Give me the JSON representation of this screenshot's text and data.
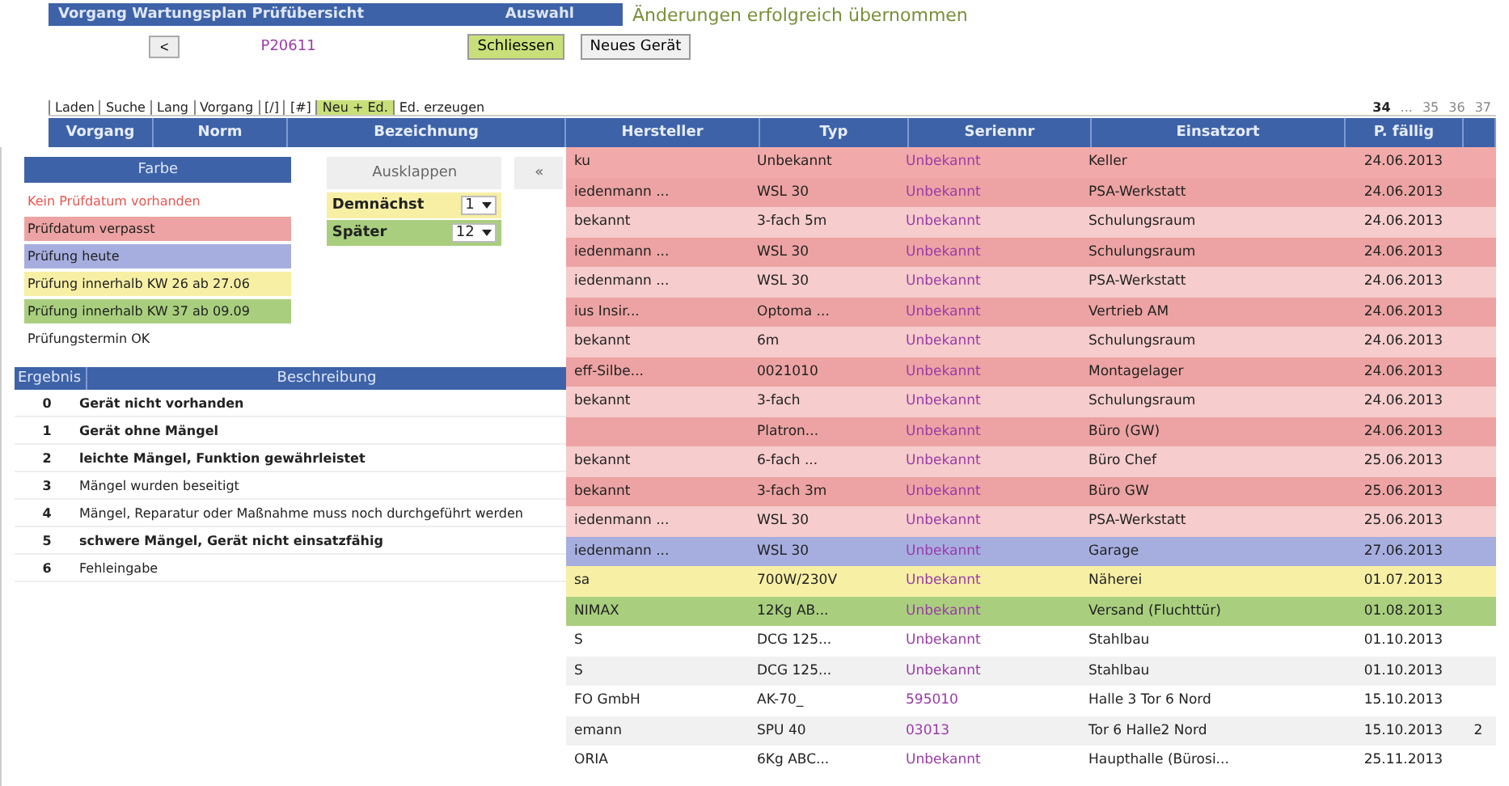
{
  "header": {
    "title": "Vorgang Wartungsplan Prüfübersicht",
    "selection": "Auswahl",
    "message": "Änderungen erfolgreich übernommen"
  },
  "toolbar": {
    "back_button": "<",
    "record": "P20611",
    "buttons": [
      {
        "label": "Schliessen",
        "kind": "primary"
      },
      {
        "label": "Neues Gerät",
        "kind": "plain"
      }
    ]
  },
  "tabs": [
    {
      "label": "Laden",
      "selected": false
    },
    {
      "label": "Suche",
      "selected": false
    },
    {
      "label": "Lang",
      "selected": false
    },
    {
      "label": "Vorgang",
      "selected": false
    },
    {
      "label": "[/]",
      "selected": false
    },
    {
      "label": "[#]",
      "selected": false
    },
    {
      "label": "Neu + Ed.",
      "selected": true
    },
    {
      "label": "Ed. erzeugen",
      "selected": false
    }
  ],
  "pagination": [
    {
      "label": "34",
      "selected": true
    },
    {
      "label": "...",
      "selected": false
    },
    {
      "label": "35",
      "selected": false
    },
    {
      "label": "36",
      "selected": false
    },
    {
      "label": "37",
      "selected": false
    }
  ],
  "table": {
    "columns": [
      "Vorgang",
      "Norm",
      "Bezeichnung",
      "Hersteller",
      "Typ",
      "Seriennr",
      "Einsatzort",
      "P. fällig"
    ],
    "rows": [
      {
        "hersteller": "ku",
        "typ": "Unbekannt",
        "seriennr": "Unbekannt",
        "einsatzort": "Keller",
        "faellig": "24.06.2013",
        "color": "#f2a9a9"
      },
      {
        "hersteller": "iedenmann ...",
        "typ": "WSL 30",
        "seriennr": "Unbekannt",
        "einsatzort": "PSA-Werkstatt",
        "faellig": "24.06.2013",
        "color": "#eda3a3"
      },
      {
        "hersteller": "bekannt",
        "typ": "3-fach 5m",
        "seriennr": "Unbekannt",
        "einsatzort": "Schulungsraum",
        "faellig": "24.06.2013",
        "color": "#f6cccc"
      },
      {
        "hersteller": "iedenmann ...",
        "typ": "WSL 30",
        "seriennr": "Unbekannt",
        "einsatzort": "Schulungsraum",
        "faellig": "24.06.2013",
        "color": "#eda3a3"
      },
      {
        "hersteller": "iedenmann ...",
        "typ": "WSL 30",
        "seriennr": "Unbekannt",
        "einsatzort": "PSA-Werkstatt",
        "faellig": "24.06.2013",
        "color": "#f6cccc"
      },
      {
        "hersteller": "ius Insir...",
        "typ": "Optoma ...",
        "seriennr": "Unbekannt",
        "einsatzort": "Vertrieb AM",
        "faellig": "24.06.2013",
        "color": "#eda3a3"
      },
      {
        "hersteller": "bekannt",
        "typ": "6m",
        "seriennr": "Unbekannt",
        "einsatzort": "Schulungsraum",
        "faellig": "24.06.2013",
        "color": "#f6cccc"
      },
      {
        "hersteller": "eff-Silbe...",
        "typ": "0021010",
        "seriennr": "Unbekannt",
        "einsatzort": "Montagelager",
        "faellig": "24.06.2013",
        "color": "#eda3a3"
      },
      {
        "hersteller": "bekannt",
        "typ": "3-fach",
        "seriennr": "Unbekannt",
        "einsatzort": "Schulungsraum",
        "faellig": "24.06.2013",
        "color": "#f6cccc"
      },
      {
        "typ": "Platron...",
        "seriennr": "Unbekannt",
        "einsatzort": "Büro (GW)",
        "faellig": "24.06.2013",
        "color": "#eda3a3"
      },
      {
        "hersteller": "bekannt",
        "typ": "6-fach ...",
        "seriennr": "Unbekannt",
        "einsatzort": "Büro Chef",
        "faellig": "25.06.2013",
        "color": "#f6cccc"
      },
      {
        "hersteller": "bekannt",
        "typ": "3-fach 3m",
        "seriennr": "Unbekannt",
        "einsatzort": "Büro GW",
        "faellig": "25.06.2013",
        "color": "#eda3a3"
      },
      {
        "hersteller": "iedenmann ...",
        "typ": "WSL 30",
        "seriennr": "Unbekannt",
        "einsatzort": "PSA-Werkstatt",
        "faellig": "25.06.2013",
        "color": "#f6cccc"
      },
      {
        "hersteller": "iedenmann ...",
        "typ": "WSL 30",
        "seriennr": "Unbekannt",
        "einsatzort": "Garage",
        "faellig": "27.06.2013",
        "color": "#a6aee0"
      },
      {
        "hersteller": "sa",
        "typ": "700W/230V",
        "seriennr": "Unbekannt",
        "einsatzort": "Näherei",
        "faellig": "01.07.2013",
        "color": "#f7efa4"
      },
      {
        "hersteller": "NIMAX",
        "typ": "12Kg AB...",
        "seriennr": "Unbekannt",
        "einsatzort": "Versand (Fluchttür)",
        "faellig": "01.08.2013",
        "color": "#a9cf7e"
      },
      {
        "hersteller": "S",
        "typ": "DCG 125...",
        "seriennr": "Unbekannt",
        "einsatzort": "Stahlbau",
        "faellig": "01.10.2013",
        "color": "#ffffff"
      },
      {
        "hersteller": "S",
        "typ": "DCG 125...",
        "seriennr": "Unbekannt",
        "einsatzort": "Stahlbau",
        "faellig": "01.10.2013",
        "color": "#f1f1f1"
      },
      {
        "hersteller": "FO GmbH",
        "typ": "AK-70_",
        "seriennr": "595010",
        "einsatzort": "Halle 3 Tor 6 Nord",
        "faellig": "15.10.2013",
        "color": "#ffffff"
      },
      {
        "hersteller": "emann",
        "typ": "SPU 40",
        "seriennr": "03013",
        "einsatzort": "Tor 6 Halle2 Nord",
        "faellig": "15.10.2013",
        "column_9": "2",
        "color": "#f1f1f1"
      },
      {
        "hersteller": "ORIA",
        "typ": "6Kg ABC...",
        "seriennr": "Unbekannt",
        "einsatzort": "Haupthalle (Bürosi...",
        "faellig": "25.11.2013",
        "color": "#ffffff"
      }
    ]
  },
  "legend": {
    "title": "Farbe",
    "items": [
      {
        "label": "Kein Prüfdatum vorhanden",
        "kind": "text",
        "color": "#e8564f"
      },
      {
        "label": "Prüfdatum verpasst",
        "kind": "fill",
        "color": "#eda3a3"
      },
      {
        "label": "Prüfung heute",
        "kind": "fill",
        "color": "#a6aee0"
      },
      {
        "label": "Prüfung innerhalb KW 26 ab 27.06",
        "kind": "fill",
        "color": "#f7efa4"
      },
      {
        "label": "Prüfung innerhalb KW 37 ab 09.09",
        "kind": "fill",
        "color": "#a9cf7e"
      },
      {
        "label": "Prüfungstermin OK",
        "kind": "fill",
        "color": "#ffffff"
      }
    ]
  },
  "options": {
    "expand_button": "Ausklappen",
    "collapse_button": "«",
    "settings": [
      {
        "label": "Demnächst",
        "value": "1",
        "color": "#f7efa4"
      },
      {
        "label": "Später",
        "value": "12",
        "color": "#a9cf7e"
      }
    ]
  },
  "results": {
    "columns": [
      "Ergebnis",
      "Beschreibung"
    ],
    "rows": [
      {
        "code": "0",
        "text": "Gerät nicht vorhanden",
        "bold": true
      },
      {
        "code": "1",
        "text": "Gerät ohne Mängel",
        "bold": true
      },
      {
        "code": "2",
        "text": "leichte Mängel, Funktion gewährleistet",
        "bold": true
      },
      {
        "code": "3",
        "text": "Mängel wurden beseitigt",
        "bold": false
      },
      {
        "code": "4",
        "text": "Mängel, Reparatur oder Maßnahme muss noch durchgeführt werden",
        "bold": false
      },
      {
        "code": "5",
        "text": "schwere Mängel, Gerät nicht einsatzfähig",
        "bold": true
      },
      {
        "code": "6",
        "text": "Fehleingabe",
        "bold": false
      }
    ]
  }
}
